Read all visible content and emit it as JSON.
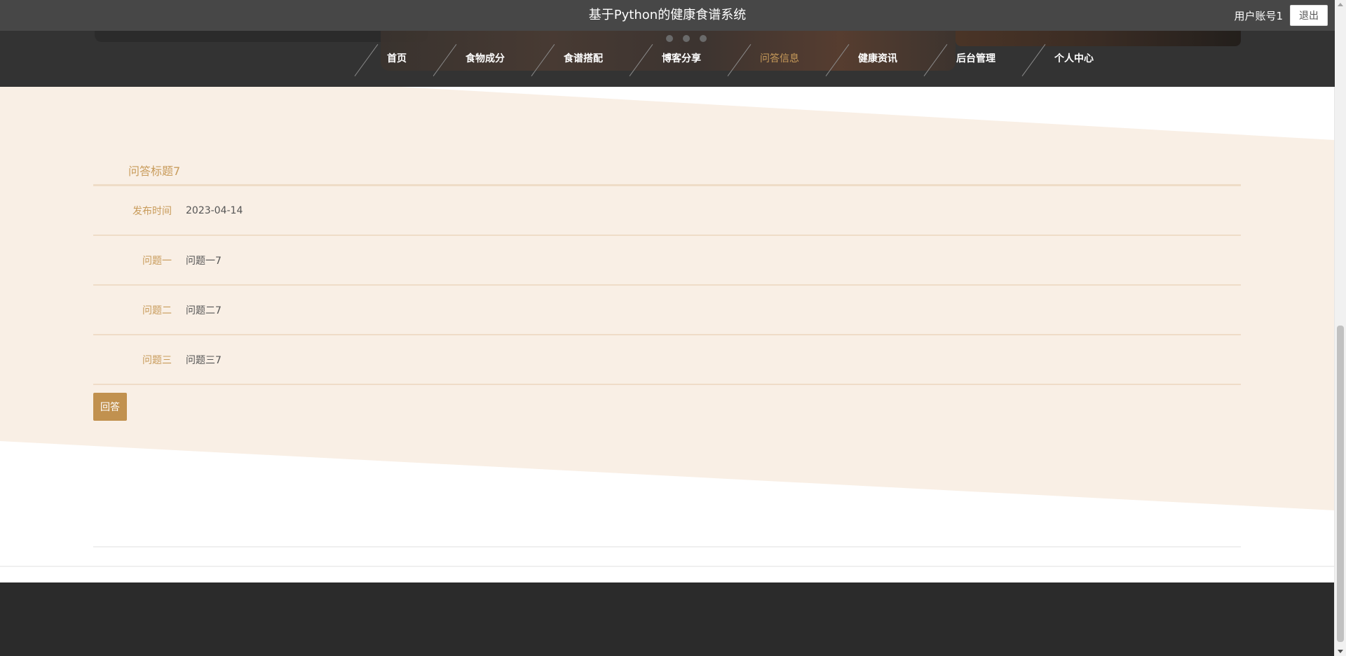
{
  "header": {
    "site_title": "基于Python的健康食谱系统",
    "username": "用户账号1",
    "logout_label": "退出"
  },
  "nav": {
    "items": [
      {
        "label": "首页",
        "active": false
      },
      {
        "label": "食物成分",
        "active": false
      },
      {
        "label": "食谱搭配",
        "active": false
      },
      {
        "label": "博客分享",
        "active": false
      },
      {
        "label": "问答信息",
        "active": true
      },
      {
        "label": "健康资讯",
        "active": false
      },
      {
        "label": "后台管理",
        "active": false
      },
      {
        "label": "个人中心",
        "active": false
      }
    ]
  },
  "detail": {
    "title": "问答标题7",
    "rows": [
      {
        "label": "发布时间",
        "value": "2023-04-14"
      },
      {
        "label": "问题一",
        "value": "问题一7"
      },
      {
        "label": "问题二",
        "value": "问题二7"
      },
      {
        "label": "问题三",
        "value": "问题三7"
      }
    ],
    "answer_label": "回答"
  },
  "colors": {
    "accent": "#c89b5a",
    "button": "#c1914f",
    "band": "#f9efe5",
    "header": "#474747",
    "footer": "#2b2b2b"
  }
}
